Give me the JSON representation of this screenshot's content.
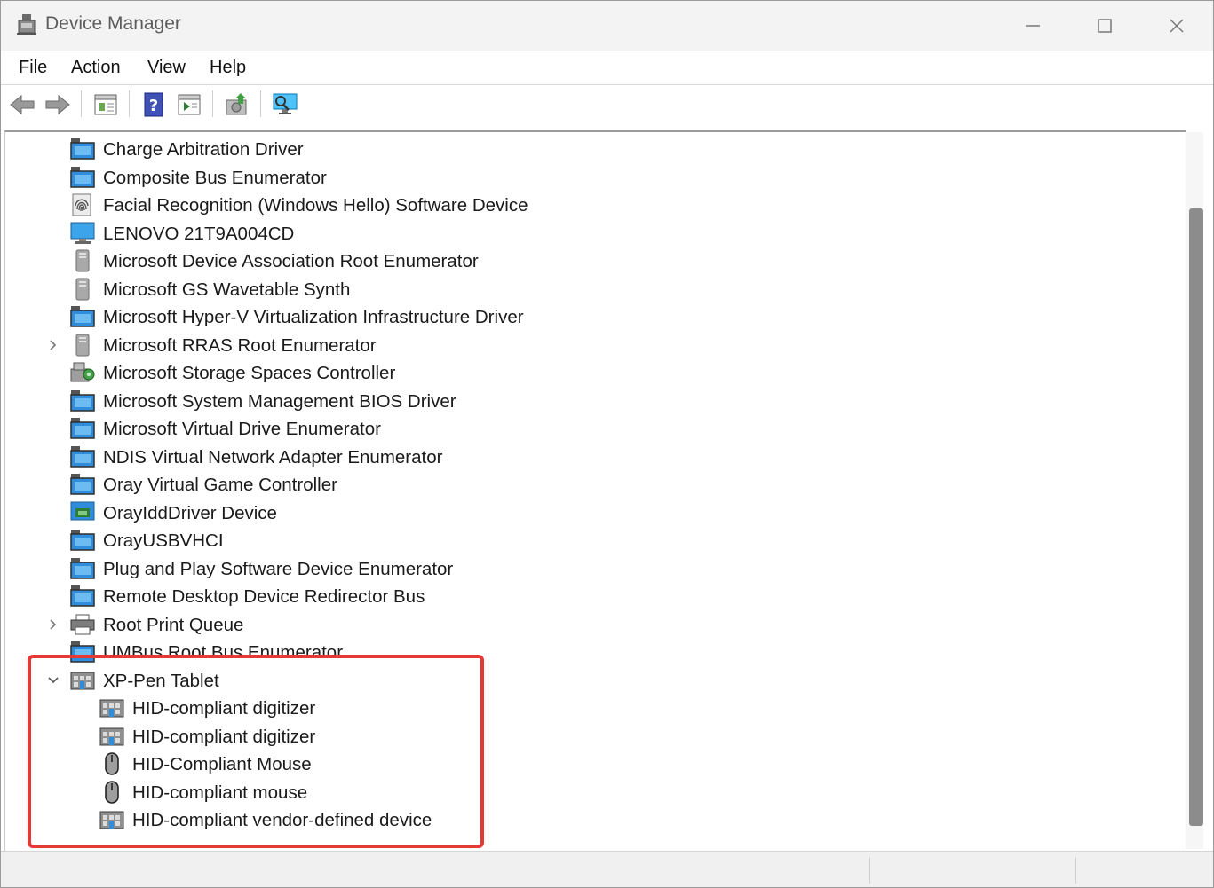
{
  "window": {
    "title": "Device Manager"
  },
  "menu": {
    "items": [
      {
        "label": "File"
      },
      {
        "label": "Action"
      },
      {
        "label": "View"
      },
      {
        "label": "Help"
      }
    ]
  },
  "toolbar": {
    "buttons": [
      {
        "icon": "back-arrow-icon"
      },
      {
        "icon": "forward-arrow-icon"
      },
      {
        "icon": "properties-icon"
      },
      {
        "icon": "help-icon"
      },
      {
        "icon": "run-icon"
      },
      {
        "icon": "update-driver-icon"
      },
      {
        "icon": "scan-hardware-icon"
      }
    ]
  },
  "tree": {
    "items": [
      {
        "label": "Charge Arbitration Driver",
        "icon": "system-device-icon"
      },
      {
        "label": "Composite Bus Enumerator",
        "icon": "system-device-icon"
      },
      {
        "label": "Facial Recognition (Windows Hello) Software Device",
        "icon": "fingerprint-icon"
      },
      {
        "label": "LENOVO 21T9A004CD",
        "icon": "monitor-icon"
      },
      {
        "label": "Microsoft Device Association Root Enumerator",
        "icon": "tower-icon"
      },
      {
        "label": "Microsoft GS Wavetable Synth",
        "icon": "tower-icon"
      },
      {
        "label": "Microsoft Hyper-V Virtualization Infrastructure Driver",
        "icon": "system-device-icon"
      },
      {
        "label": "Microsoft RRAS Root Enumerator",
        "icon": "tower-icon",
        "expander": "collapsed"
      },
      {
        "label": "Microsoft Storage Spaces Controller",
        "icon": "storage-icon"
      },
      {
        "label": "Microsoft System Management BIOS Driver",
        "icon": "system-device-icon"
      },
      {
        "label": "Microsoft Virtual Drive Enumerator",
        "icon": "system-device-icon"
      },
      {
        "label": "NDIS Virtual Network Adapter Enumerator",
        "icon": "system-device-icon"
      },
      {
        "label": "Oray Virtual Game Controller",
        "icon": "system-device-icon"
      },
      {
        "label": "OrayIddDriver Device",
        "icon": "display-adapter-icon"
      },
      {
        "label": "OrayUSBVHCI",
        "icon": "system-device-icon"
      },
      {
        "label": "Plug and Play Software Device Enumerator",
        "icon": "system-device-icon"
      },
      {
        "label": "Remote Desktop Device Redirector Bus",
        "icon": "system-device-icon"
      },
      {
        "label": "Root Print Queue",
        "icon": "printer-icon",
        "expander": "collapsed"
      },
      {
        "label": "UMBus Root Bus Enumerator",
        "icon": "system-device-icon"
      },
      {
        "label": "XP-Pen Tablet",
        "icon": "hid-icon",
        "expander": "expanded"
      },
      {
        "label": "HID-compliant digitizer",
        "icon": "hid-icon",
        "child": true
      },
      {
        "label": "HID-compliant digitizer",
        "icon": "hid-icon",
        "child": true
      },
      {
        "label": "HID-Compliant Mouse",
        "icon": "mouse-icon",
        "child": true
      },
      {
        "label": "HID-compliant mouse",
        "icon": "mouse-icon",
        "child": true
      },
      {
        "label": "HID-compliant vendor-defined device",
        "icon": "hid-icon",
        "child": true
      }
    ]
  },
  "colors": {
    "highlight": "#e53935",
    "device_blue": "#1e88d8"
  }
}
